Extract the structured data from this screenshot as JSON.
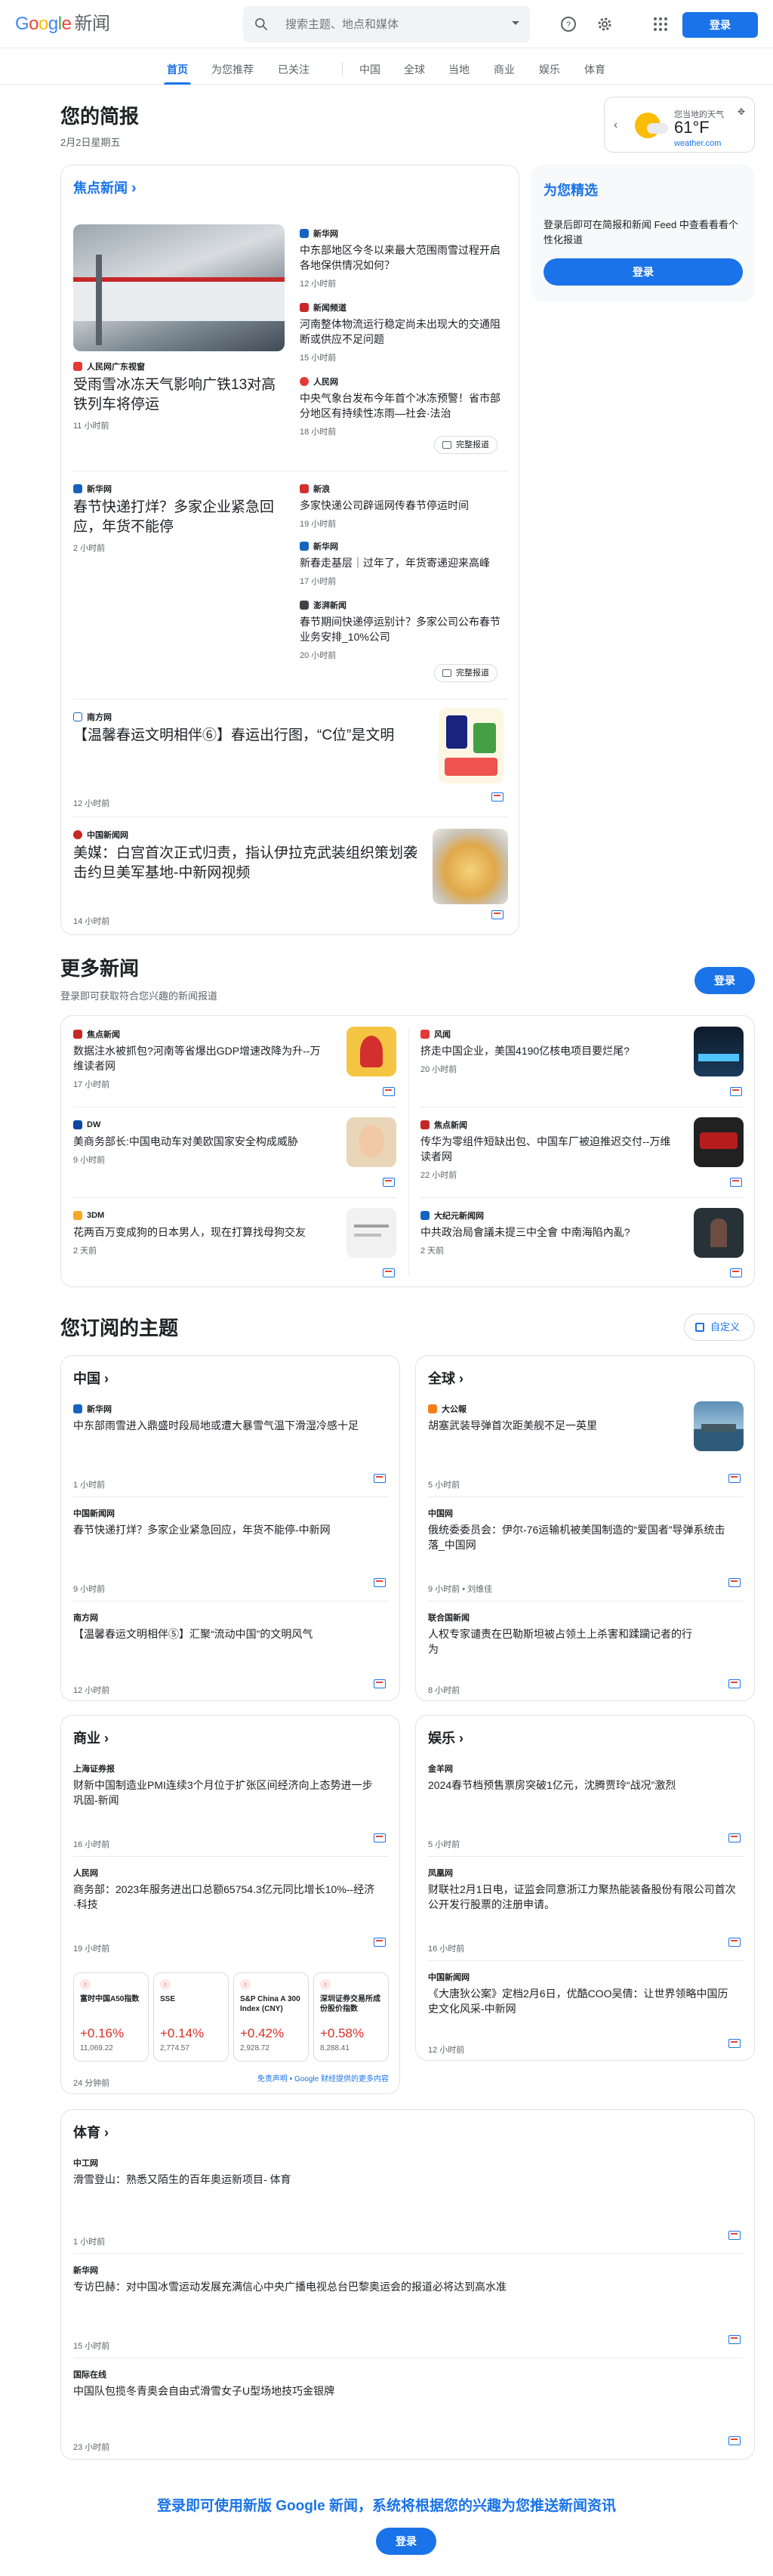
{
  "header": {
    "logo_google": "Google",
    "logo_news": "新闻",
    "search_placeholder": "搜索主题、地点和媒体",
    "signin": "登录"
  },
  "nav": [
    "首页",
    "为您推荐",
    "已关注",
    "中国",
    "全球",
    "当地",
    "商业",
    "娱乐",
    "体育"
  ],
  "briefing": {
    "title": "您的简报",
    "date": "2月2日星期五"
  },
  "weather": {
    "location": "您当地的天气",
    "temp": "61°F",
    "source": "weather.com"
  },
  "top_stories": {
    "link": "焦点新闻",
    "c1": {
      "main": {
        "source": "人民网广东视窗",
        "headline": "受雨雪冰冻天气影响广铁13对高铁列车将停运",
        "time": "11 小时前"
      },
      "side": [
        {
          "source": "新华网",
          "headline": "中东部地区今冬以来最大范围雨雪过程开启 各地保供情况如何？",
          "time": "12 小时前"
        },
        {
          "source": "新闻频道",
          "headline": "河南整体物流运行稳定尚未出现大的交通阻断或供应不足问题",
          "time": "15 小时前"
        },
        {
          "source": "人民网",
          "headline": "中央气象台发布今年首个冰冻预警！省市部分地区有持续性冻雨—社会·法治",
          "time": "18 小时前"
        }
      ],
      "full": "完整报道"
    },
    "c2": {
      "main": {
        "source": "新华网",
        "headline": "春节快递打烊？多家企业紧急回应，年货不能停",
        "time": "2 小时前"
      },
      "side": [
        {
          "source": "新浪",
          "headline": "多家快递公司辟谣网传春节停运时间",
          "time": "19 小时前"
        },
        {
          "source": "新华网",
          "headline": "新春走基层｜过年了，年货寄递迎来高峰",
          "time": "17 小时前"
        },
        {
          "source": "澎湃新闻",
          "headline": "春节期间快递停运别计？多家公司公布春节业务安排_10%公司",
          "time": "20 小时前"
        }
      ],
      "full": "完整报道"
    },
    "c3": {
      "source": "南方网",
      "headline": "【温馨春运文明相伴⑥】春运出行图，“C位”是文明",
      "time": "12 小时前"
    },
    "c4": {
      "source": "中国新闻网",
      "headline": "美媒：白宫首次正式归责，指认伊拉克武装组织策划袭击约旦美军基地-中新网视频",
      "time": "14 小时前"
    }
  },
  "for_you": {
    "title": "为您精选",
    "text": "登录后即可在简报和新闻 Feed 中查看看看个性化报道",
    "btn": "登录"
  },
  "more": {
    "title": "更多新闻",
    "subtitle": "登录即可获取符合您兴趣的新闻报道",
    "btn": "登录",
    "items": [
      {
        "source": "焦点新闻",
        "headline": "数据注水被抓包?河南等省爆出GDP增速改降为升--万维读者网",
        "time": "17 小时前"
      },
      {
        "source": "风闻",
        "headline": "挤走中国企业，美国4190亿核电项目要烂尾?",
        "time": "20 小时前"
      },
      {
        "source": "DW",
        "headline": "美商务部长:中国电动车对美欧国家安全构成威胁",
        "time": "9 小时前"
      },
      {
        "source": "焦点新闻",
        "headline": "传华为零组件短缺出包、中国车厂被迫推迟交付--万维读者网",
        "time": "22 小时前"
      },
      {
        "source": "3DM",
        "headline": "花两百万变成狗的日本男人，现在打算找母狗交友",
        "time": "2 天前"
      },
      {
        "source": "大纪元新闻网",
        "headline": "中共政治局會議未提三中全會 中南海陷內亂?",
        "time": "2 天前"
      }
    ]
  },
  "topics": {
    "title": "您订阅的主题",
    "custom": "自定义",
    "china": {
      "title": "中国",
      "items": [
        {
          "source": "新华网",
          "headline": "中东部雨雪进入鼎盛时段局地或遭大暴雪气温下滑湿冷感十足",
          "time": "1 小时前"
        },
        {
          "source": "中国新闻网",
          "headline": "春节快递打烊？多家企业紧急回应，年货不能停-中新网",
          "time": "9 小时前"
        },
        {
          "source": "南方网",
          "headline": "【温馨春运文明相伴⑤】汇聚“流动中国”的文明风气",
          "time": "12 小时前"
        }
      ]
    },
    "world": {
      "title": "全球",
      "items": [
        {
          "source": "大公報",
          "headline": "胡塞武装导弹首次距美舰不足一英里",
          "time": "5 小时前"
        },
        {
          "source": "中国网",
          "headline": "俄统委委员会：伊尔-76运输机被美国制造的“爱国者”导弹系统击落_中国网",
          "time": "9 小时前 • 刘维佳"
        },
        {
          "source": "联合国新闻",
          "headline": "人权专家谴责在巴勒斯坦被占领土上杀害和蹂躏记者的行为",
          "time": "8 小时前"
        }
      ]
    },
    "business": {
      "title": "商业",
      "items": [
        {
          "source": "上海证券报",
          "headline": "财新中国制造业PMI连续3个月位于扩张区间经济向上态势进一步巩固-新闻",
          "time": "16 小时前"
        },
        {
          "source": "人民网",
          "headline": "商务部：2023年服务进出口总额65754.3亿元同比增长10%--经济·科技",
          "time": "19 小时前"
        }
      ],
      "stocks": [
        {
          "name": "富时中国A50指数",
          "pct": "+0.16%",
          "val": "11,069.22"
        },
        {
          "name": "SSE",
          "pct": "+0.14%",
          "val": "2,774.57"
        },
        {
          "name": "S&P China A 300 Index (CNY)",
          "pct": "+0.42%",
          "val": "2,928.72"
        },
        {
          "name": "深圳证券交易所成份股价指数",
          "pct": "+0.58%",
          "val": "8,288.41"
        }
      ],
      "stocks_time": "24 分钟前",
      "disclaimer": "免责声明 • Google 财经提供的更多内容"
    },
    "ent": {
      "title": "娱乐",
      "items": [
        {
          "source": "金羊网",
          "headline": "2024春节档预售票房突破1亿元，沈腾贾玲“战况”激烈",
          "time": "5 小时前"
        },
        {
          "source": "凤凰网",
          "headline": "财联社2月1日电，证监会同意浙江力聚热能装备股份有限公司首次公开发行股票的注册申请。",
          "time": "16 小时前"
        },
        {
          "source": "中国新闻网",
          "headline": "《大唐狄公案》定档2月6日，优酷COO吴倩：让世界领略中国历史文化风采-中新网",
          "time": "12 小时前"
        }
      ]
    },
    "sports": {
      "title": "体育",
      "items": [
        {
          "source": "中工网",
          "headline": "滑雪登山：熟悉又陌生的百年奥运新项目- 体育",
          "time": "1 小时前"
        },
        {
          "source": "新华网",
          "headline": "专访巴赫：对中国冰雪运动发展充满信心中央广播电视总台巴黎奥运会的报道必将达到高水准",
          "time": "15 小时前"
        },
        {
          "source": "国际在线",
          "headline": "中国队包揽冬青奥会自由式滑雪女子U型场地技巧金银牌",
          "time": "23 小时前"
        }
      ]
    }
  },
  "footer": {
    "text": "登录即可使用新版 Google 新闻，系统将根据您的兴趣为您推送新闻资讯",
    "btn": "登录"
  }
}
